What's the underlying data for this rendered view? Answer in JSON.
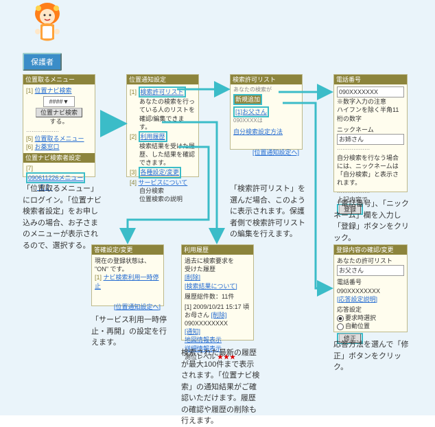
{
  "badge": "保護者",
  "panel1": {
    "title": "位置取るメニュー",
    "k1": "[1]",
    "l1": "位置ナビ検索",
    "input_placeholder": "####",
    "btn": "位置ナビ検索",
    "sub1": "する。",
    "k5": "[5]",
    "l5": "位置取るメニュー",
    "k6": "[6]",
    "l6": "お薬窓口",
    "title2": "位置ナビ検索者設定",
    "k7": "[7]",
    "l7a": "090611226メニュー",
    "l7b": "【↓】"
  },
  "cap1": "「位置取るメニュー」にログイン。「位置ナビ検索者設定」をお申し込みの場合、お子さまのメニューが表示されるので、選択する。",
  "panel2": {
    "title": "位置通知設定",
    "k1": "[1]",
    "l1": "検索許可リスト",
    "d1": "あなたの検索を行っている人のリストを確認/編集できます。",
    "k2": "[2]",
    "l2": "利用履歴",
    "d2": "検索結果を受けた履歴、した結果を確認できます。",
    "k3": "[3]",
    "l3": "各種設定/変更",
    "k4": "[4]",
    "l4": "サービスについて",
    "d4a": "自分検索",
    "d4b": "位置検索の説明"
  },
  "panel3": {
    "title": "検索許可リスト",
    "hdr": "あなたの検索が",
    "row": "[1]お父さん",
    "sub": "090XXXXは",
    "l2": "新規追加",
    "l3": "自分検索設定方法",
    "back": "[位置通知設定へ]"
  },
  "cap3": "「検索許可リスト」を選んだ場合、このように表示されます。保護者側で検索許可リストの編集を行えます。",
  "panel4": {
    "title": "電話番号",
    "val": "090XXXXXXX",
    "note": "※数字入力の注意\nハイフンを除く半角11桁の数字",
    "nick_lbl": "ニックネーム",
    "nick_val": "お姉さん",
    "body": "自分検索を行なう場合には、ニックネームは「自分検索」と表示されます。",
    "hint": "上記内容で",
    "btn": "登録"
  },
  "cap4": "「電話番号」、「ニックネーム」欄を入力し「登録」ボタンをクリック。",
  "panel5": {
    "title": "答確設定/変更",
    "l0": "現在の登録状態は、",
    "l0b": "\"ON\" です。",
    "k1": "[1]",
    "l1": "ナビ検索利用一時停止",
    "back": "[位置通知設定へ]"
  },
  "cap5": "「サービス利用一時停止・再開」の設定を行えます。",
  "panel6": {
    "title": "利用履歴",
    "lead": "過去に検索要求を\n受けた履歴",
    "del": "[削除]",
    "about": "[検索結果について]",
    "count": "履歴総件数：11件",
    "r1": "[1] 2009/10/21 15:17 頃",
    "r2": "お母さん ",
    "r2b": "[削除]",
    "r3": "090XXXXXXXX",
    "r4": "[通知]",
    "r5": "地図情報表示",
    "r6": "詳細情報表示",
    "r7": "測位レベル ",
    "r7s": "★★★"
  },
  "cap6": "検索された最新の履歴が最大100件まで表示されます。「位置ナビ検索」の通知結果がご確認いただけます。履歴の確認や履歴の削除も行えます。",
  "panel7": {
    "title": "登録内容の確認/変更",
    "l1": "あなたの許可リスト",
    "l1v": "お父さん",
    "l2": "電話番号",
    "l2v": "090XXXXXXXX",
    "l3": "[応答設定説明]",
    "l4": "応答設定",
    "o1": "要求時選択",
    "o2": "自動位置",
    "btn": "修正"
  },
  "cap7": "応答方法を選んで「修正」ボタンをクリック。"
}
